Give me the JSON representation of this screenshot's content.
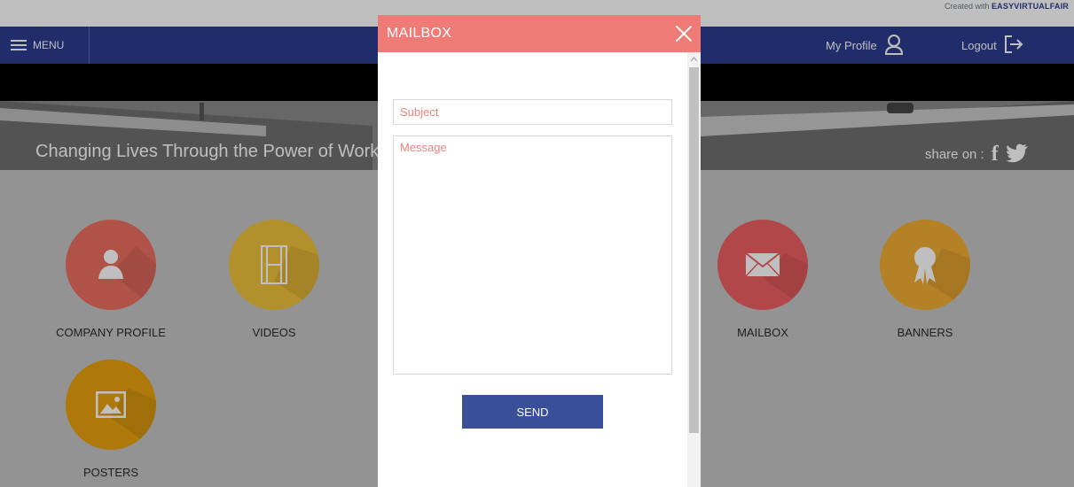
{
  "credit": {
    "prefix": "Created with",
    "brand": "EASYVIRTUALFAIR"
  },
  "nav": {
    "menu_label": "MENU",
    "profile_label": "My Profile",
    "logout_label": "Logout"
  },
  "banner": {
    "tagline": "Changing Lives Through the Power of Work",
    "share_label": "share on :"
  },
  "tiles": [
    {
      "label": "COMPANY PROFILE",
      "icon": "person-icon",
      "color": "#ec6e61"
    },
    {
      "label": "VIDEOS",
      "icon": "film-icon",
      "color": "#eec13a"
    },
    {
      "label": "MAILBOX",
      "icon": "envelope-icon",
      "color": "#ee5f62"
    },
    {
      "label": "BANNERS",
      "icon": "ribbon-icon",
      "color": "#f1ac33"
    },
    {
      "label": "POSTERS",
      "icon": "image-icon",
      "color": "#e8a20e"
    }
  ],
  "modal": {
    "title": "MAILBOX",
    "subject_placeholder": "Subject",
    "message_placeholder": "Message",
    "send_label": "SEND"
  },
  "colors": {
    "navbar": "#2c3d8f",
    "modal_header": "#ee7b76",
    "send_button": "#3a4f99",
    "placeholder": "#e6847e"
  }
}
